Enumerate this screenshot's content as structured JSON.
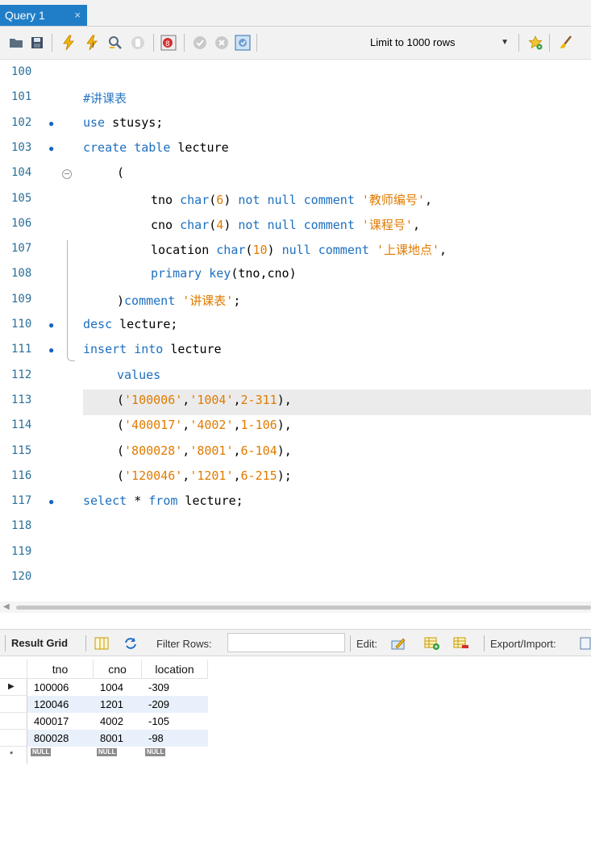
{
  "tab": {
    "title": "Query 1",
    "close": "×"
  },
  "toolbar": {
    "icons": [
      "open-folder-icon",
      "save-icon",
      "execute-icon",
      "execute-current-icon",
      "explain-icon",
      "stop-icon",
      "toggle-error-icon",
      "commit-icon",
      "rollback-icon",
      "autocommit-icon",
      "add-snippet-icon",
      "beautify-icon"
    ],
    "limit_label": "Limit to 1000 rows"
  },
  "editor": {
    "lines": [
      {
        "n": "100",
        "dot": false,
        "indent": 0,
        "tokens": []
      },
      {
        "n": "101",
        "dot": false,
        "indent": 0,
        "tokens": [
          {
            "t": "#讲课表",
            "c": "cmt"
          }
        ]
      },
      {
        "n": "102",
        "dot": true,
        "indent": 0,
        "tokens": [
          {
            "t": "use",
            "c": "kw"
          },
          {
            "t": " stusys;",
            "c": ""
          }
        ]
      },
      {
        "n": "103",
        "dot": true,
        "indent": 0,
        "tokens": [
          {
            "t": "create",
            "c": "kw"
          },
          {
            "t": " ",
            "c": ""
          },
          {
            "t": "table",
            "c": "kw"
          },
          {
            "t": " lecture",
            "c": ""
          }
        ]
      },
      {
        "n": "104",
        "dot": false,
        "indent": 1,
        "fold": true,
        "tokens": [
          {
            "t": "(",
            "c": ""
          }
        ]
      },
      {
        "n": "105",
        "dot": false,
        "indent": 2,
        "tokens": [
          {
            "t": "tno ",
            "c": ""
          },
          {
            "t": "char",
            "c": "kw"
          },
          {
            "t": "(",
            "c": ""
          },
          {
            "t": "6",
            "c": "num"
          },
          {
            "t": ") ",
            "c": ""
          },
          {
            "t": "not null comment",
            "c": "kw"
          },
          {
            "t": " ",
            "c": ""
          },
          {
            "t": "'教师编号'",
            "c": "str"
          },
          {
            "t": ",",
            "c": ""
          }
        ]
      },
      {
        "n": "106",
        "dot": false,
        "indent": 2,
        "tokens": [
          {
            "t": "cno ",
            "c": ""
          },
          {
            "t": "char",
            "c": "kw"
          },
          {
            "t": "(",
            "c": ""
          },
          {
            "t": "4",
            "c": "num"
          },
          {
            "t": ") ",
            "c": ""
          },
          {
            "t": "not null comment",
            "c": "kw"
          },
          {
            "t": " ",
            "c": ""
          },
          {
            "t": "'课程号'",
            "c": "str"
          },
          {
            "t": ",",
            "c": ""
          }
        ]
      },
      {
        "n": "107",
        "dot": false,
        "indent": 2,
        "tokens": [
          {
            "t": "location ",
            "c": ""
          },
          {
            "t": "char",
            "c": "kw"
          },
          {
            "t": "(",
            "c": ""
          },
          {
            "t": "10",
            "c": "num"
          },
          {
            "t": ") ",
            "c": ""
          },
          {
            "t": "null comment",
            "c": "kw"
          },
          {
            "t": " ",
            "c": ""
          },
          {
            "t": "'上课地点'",
            "c": "str"
          },
          {
            "t": ",",
            "c": ""
          }
        ]
      },
      {
        "n": "108",
        "dot": false,
        "indent": 2,
        "tokens": [
          {
            "t": "primary key",
            "c": "kw"
          },
          {
            "t": "(tno,cno)",
            "c": ""
          }
        ]
      },
      {
        "n": "109",
        "dot": false,
        "indent": 1,
        "tokens": [
          {
            "t": ")",
            "c": ""
          },
          {
            "t": "comment",
            "c": "kw"
          },
          {
            "t": " ",
            "c": ""
          },
          {
            "t": "'讲课表'",
            "c": "str"
          },
          {
            "t": ";",
            "c": ""
          }
        ]
      },
      {
        "n": "110",
        "dot": true,
        "indent": 0,
        "tokens": [
          {
            "t": "desc",
            "c": "kw"
          },
          {
            "t": " lecture;",
            "c": ""
          }
        ]
      },
      {
        "n": "111",
        "dot": true,
        "indent": 0,
        "tokens": [
          {
            "t": "insert into",
            "c": "kw"
          },
          {
            "t": " lecture",
            "c": ""
          }
        ]
      },
      {
        "n": "112",
        "dot": false,
        "indent": 1,
        "tokens": [
          {
            "t": "values",
            "c": "kw"
          }
        ]
      },
      {
        "n": "113",
        "dot": false,
        "indent": 1,
        "hl": true,
        "tokens": [
          {
            "t": "(",
            "c": ""
          },
          {
            "t": "'100006'",
            "c": "str"
          },
          {
            "t": ",",
            "c": ""
          },
          {
            "t": "'1004'",
            "c": "str"
          },
          {
            "t": ",",
            "c": ""
          },
          {
            "t": "2-311",
            "c": "num"
          },
          {
            "t": "),",
            "c": ""
          }
        ]
      },
      {
        "n": "114",
        "dot": false,
        "indent": 1,
        "tokens": [
          {
            "t": "(",
            "c": ""
          },
          {
            "t": "'400017'",
            "c": "str"
          },
          {
            "t": ",",
            "c": ""
          },
          {
            "t": "'4002'",
            "c": "str"
          },
          {
            "t": ",",
            "c": ""
          },
          {
            "t": "1-106",
            "c": "num"
          },
          {
            "t": "),",
            "c": ""
          }
        ]
      },
      {
        "n": "115",
        "dot": false,
        "indent": 1,
        "tokens": [
          {
            "t": "(",
            "c": ""
          },
          {
            "t": "'800028'",
            "c": "str"
          },
          {
            "t": ",",
            "c": ""
          },
          {
            "t": "'8001'",
            "c": "str"
          },
          {
            "t": ",",
            "c": ""
          },
          {
            "t": "6-104",
            "c": "num"
          },
          {
            "t": "),",
            "c": ""
          }
        ]
      },
      {
        "n": "116",
        "dot": false,
        "indent": 1,
        "tokens": [
          {
            "t": "(",
            "c": ""
          },
          {
            "t": "'120046'",
            "c": "str"
          },
          {
            "t": ",",
            "c": ""
          },
          {
            "t": "'1201'",
            "c": "str"
          },
          {
            "t": ",",
            "c": ""
          },
          {
            "t": "6-215",
            "c": "num"
          },
          {
            "t": ");",
            "c": ""
          }
        ]
      },
      {
        "n": "117",
        "dot": true,
        "indent": 0,
        "tokens": [
          {
            "t": "select",
            "c": "kw"
          },
          {
            "t": " * ",
            "c": ""
          },
          {
            "t": "from",
            "c": "kw"
          },
          {
            "t": " lecture;",
            "c": ""
          }
        ]
      },
      {
        "n": "118",
        "dot": false,
        "indent": 0,
        "tokens": []
      },
      {
        "n": "119",
        "dot": false,
        "indent": 0,
        "tokens": []
      },
      {
        "n": "120",
        "dot": false,
        "indent": 0,
        "tokens": []
      }
    ]
  },
  "result": {
    "tab_label": "Result Grid",
    "filter_label": "Filter Rows:",
    "filter_value": "",
    "edit_label": "Edit:",
    "export_label": "Export/Import:",
    "columns": [
      "tno",
      "cno",
      "location"
    ],
    "rows": [
      [
        "100006",
        "1004",
        "-309"
      ],
      [
        "120046",
        "1201",
        "-209"
      ],
      [
        "400017",
        "4002",
        "-105"
      ],
      [
        "800028",
        "8001",
        "-98"
      ]
    ],
    "null_label": "NULL",
    "new_row_marker": "*"
  },
  "colors": {
    "accent": "#1f7ec7",
    "keyword": "#1c6fbf",
    "string": "#e07b00",
    "line_number": "#2b6f9a",
    "row_tint": "#e8f0fb"
  }
}
